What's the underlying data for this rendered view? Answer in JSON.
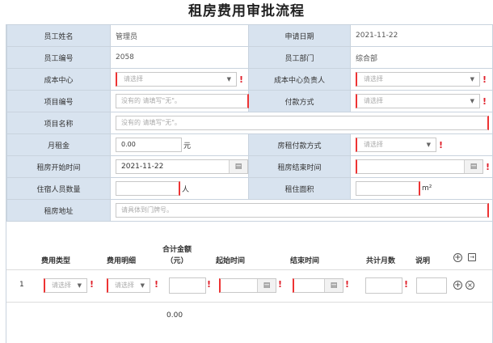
{
  "page": {
    "title": "租房费用审批流程"
  },
  "fields": {
    "employee_name": {
      "label": "员工姓名",
      "value": "管理员"
    },
    "apply_date": {
      "label": "申请日期",
      "value": "2021-11-22"
    },
    "employee_no": {
      "label": "员工编号",
      "value": "2058"
    },
    "department": {
      "label": "员工部门",
      "value": "综合部"
    },
    "cost_center": {
      "label": "成本中心",
      "placeholder": "请选择"
    },
    "cost_center_owner": {
      "label": "成本中心负责人",
      "placeholder": "请选择"
    },
    "project_no": {
      "label": "项目编号",
      "placeholder": "没有的 请填写\"无\"。"
    },
    "payment_method": {
      "label": "付款方式",
      "placeholder": "请选择"
    },
    "project_name": {
      "label": "项目名称",
      "placeholder": "没有的 请填写\"无\"。"
    },
    "monthly_rent": {
      "label": "月租金",
      "value": "0.00",
      "unit": "元"
    },
    "rent_pay_method": {
      "label": "房租付款方式",
      "placeholder": "请选择"
    },
    "rent_start": {
      "label": "租房开始时间",
      "value": "2021-11-22"
    },
    "rent_end": {
      "label": "租房结束时间",
      "value": ""
    },
    "occupants": {
      "label": "住宿人员数量",
      "unit": "人"
    },
    "area": {
      "label": "租住面积",
      "unit": "m²"
    },
    "address": {
      "label": "租房地址",
      "placeholder": "请具体到门牌号。"
    }
  },
  "detail": {
    "headers": {
      "fee_type": "费用类型",
      "fee_detail": "费用明细",
      "total_line1": "合计金额",
      "total_line2": "（元）",
      "start": "起始时间",
      "end": "结束时间",
      "months": "共计月数",
      "note": "说明"
    },
    "row": {
      "index": "1",
      "fee_type_placeholder": "请选择",
      "fee_detail_placeholder": "请选择"
    },
    "sum_total": "0.00"
  },
  "icons": {
    "add": "plus-circle-icon",
    "import": "import-icon",
    "remove": "close-circle-icon",
    "calendar": "calendar-icon",
    "dropdown": "chevron-down-icon"
  },
  "colors": {
    "label_bg": "#d8e3ef",
    "required": "#e0202a",
    "border": "#c9d3de"
  }
}
